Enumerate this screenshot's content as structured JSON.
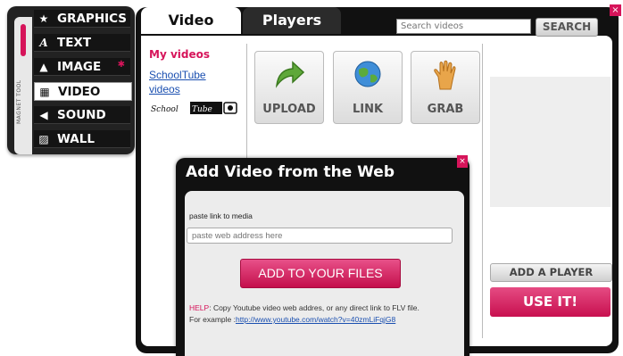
{
  "toolbox": {
    "magnet_label": "MAGNET TOOL",
    "items": [
      {
        "label": "GRAPHICS",
        "icon": "star-icon"
      },
      {
        "label": "TEXT",
        "icon": "text-a-icon"
      },
      {
        "label": "IMAGE",
        "icon": "image-icon"
      },
      {
        "label": "VIDEO",
        "icon": "film-icon"
      },
      {
        "label": "SOUND",
        "icon": "speaker-icon"
      },
      {
        "label": "WALL",
        "icon": "wall-pattern-icon"
      }
    ],
    "active": "VIDEO"
  },
  "tabs": {
    "video": "Video",
    "players": "Players"
  },
  "search": {
    "placeholder": "Search videos",
    "button": "SEARCH"
  },
  "sources": {
    "my_videos": "My videos",
    "schooltube_link": "SchoolTube videos",
    "schooltube_logo_text": "SCHOOL TUBE"
  },
  "actions": {
    "upload": "UPLOAD",
    "link": "LINK",
    "grab": "GRAB"
  },
  "right": {
    "add_player": "ADD A PLAYER",
    "use_it": "USE IT!"
  },
  "modal": {
    "title": "Add Video from the Web",
    "paste_label": "paste link to media",
    "url_placeholder": "paste web address here",
    "add_button": "ADD TO YOUR FILES",
    "help_key": "HELP",
    "help_text": ": Copy Youtube video web addres, or any direct link to FLV file.",
    "example_prefix": "For example :",
    "example_link": "http://www.youtube.com/watch?v=40zmLiFqjG8"
  },
  "colors": {
    "accent": "#d6145a",
    "dark": "#111111",
    "link": "#1a4fb0"
  }
}
